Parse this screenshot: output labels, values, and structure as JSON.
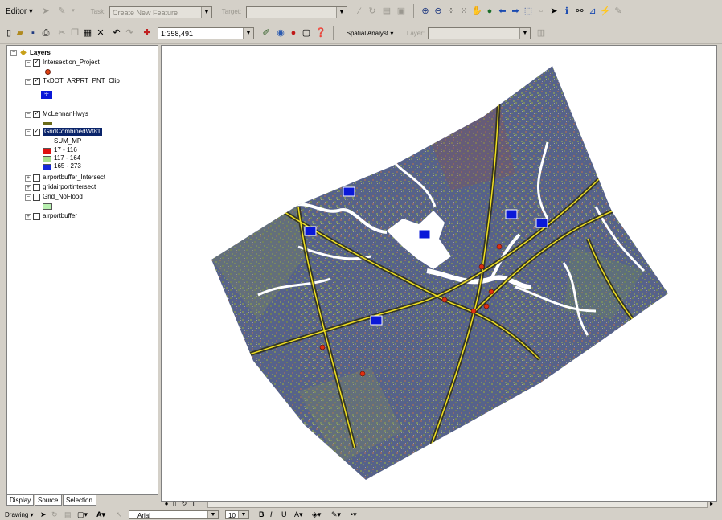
{
  "toolbar1": {
    "editor_label": "Editor ▾",
    "task_label": "Task:",
    "task_value": "Create New Feature",
    "target_label": "Target:",
    "target_value": ""
  },
  "toolbar2": {
    "scale_value": "1:358,491",
    "spatial_analyst_label": "Spatial Analyst ▾",
    "layer_label": "Layer:",
    "layer_value": ""
  },
  "toc": {
    "root_label": "Layers",
    "layers": [
      {
        "name": "Intersection_Project",
        "checked": true,
        "expanded": true
      },
      {
        "name": "TxDOT_ARPRT_PNT_Clip",
        "checked": true,
        "expanded": true
      },
      {
        "name": "McLennanHwys",
        "checked": true,
        "expanded": true
      },
      {
        "name": "GridCombinedWt81",
        "checked": true,
        "expanded": true,
        "selected": true
      },
      {
        "name": "airportbuffer_Intersect",
        "checked": false,
        "expanded": false
      },
      {
        "name": "gridairportintersect",
        "checked": false,
        "expanded": false
      },
      {
        "name": "Grid_NoFlood",
        "checked": false,
        "expanded": true
      },
      {
        "name": "airportbuffer",
        "checked": false,
        "expanded": false
      }
    ],
    "legend_field": "SUM_MP",
    "legend": [
      {
        "label": "17 - 116",
        "color": "#e01010"
      },
      {
        "label": "117 - 164",
        "color": "#a8e08c"
      },
      {
        "label": "165 - 273",
        "color": "#1428d8"
      }
    ],
    "noflood_color": "#b8f0b0"
  },
  "tabs": {
    "display": "Display",
    "source": "Source",
    "selection": "Selection"
  },
  "drawing": {
    "drawing_label": "Drawing ▾",
    "font_value": "Arial",
    "size_value": "10",
    "bold": "B",
    "italic": "I",
    "underline": "U",
    "font_color_glyph": "A"
  },
  "colors": {
    "selection": "#0a246a",
    "highway": "#f0e020",
    "grid_blue": "#4a5c88",
    "grid_green": "#7a8a60",
    "grid_red": "#8a4a4a"
  }
}
